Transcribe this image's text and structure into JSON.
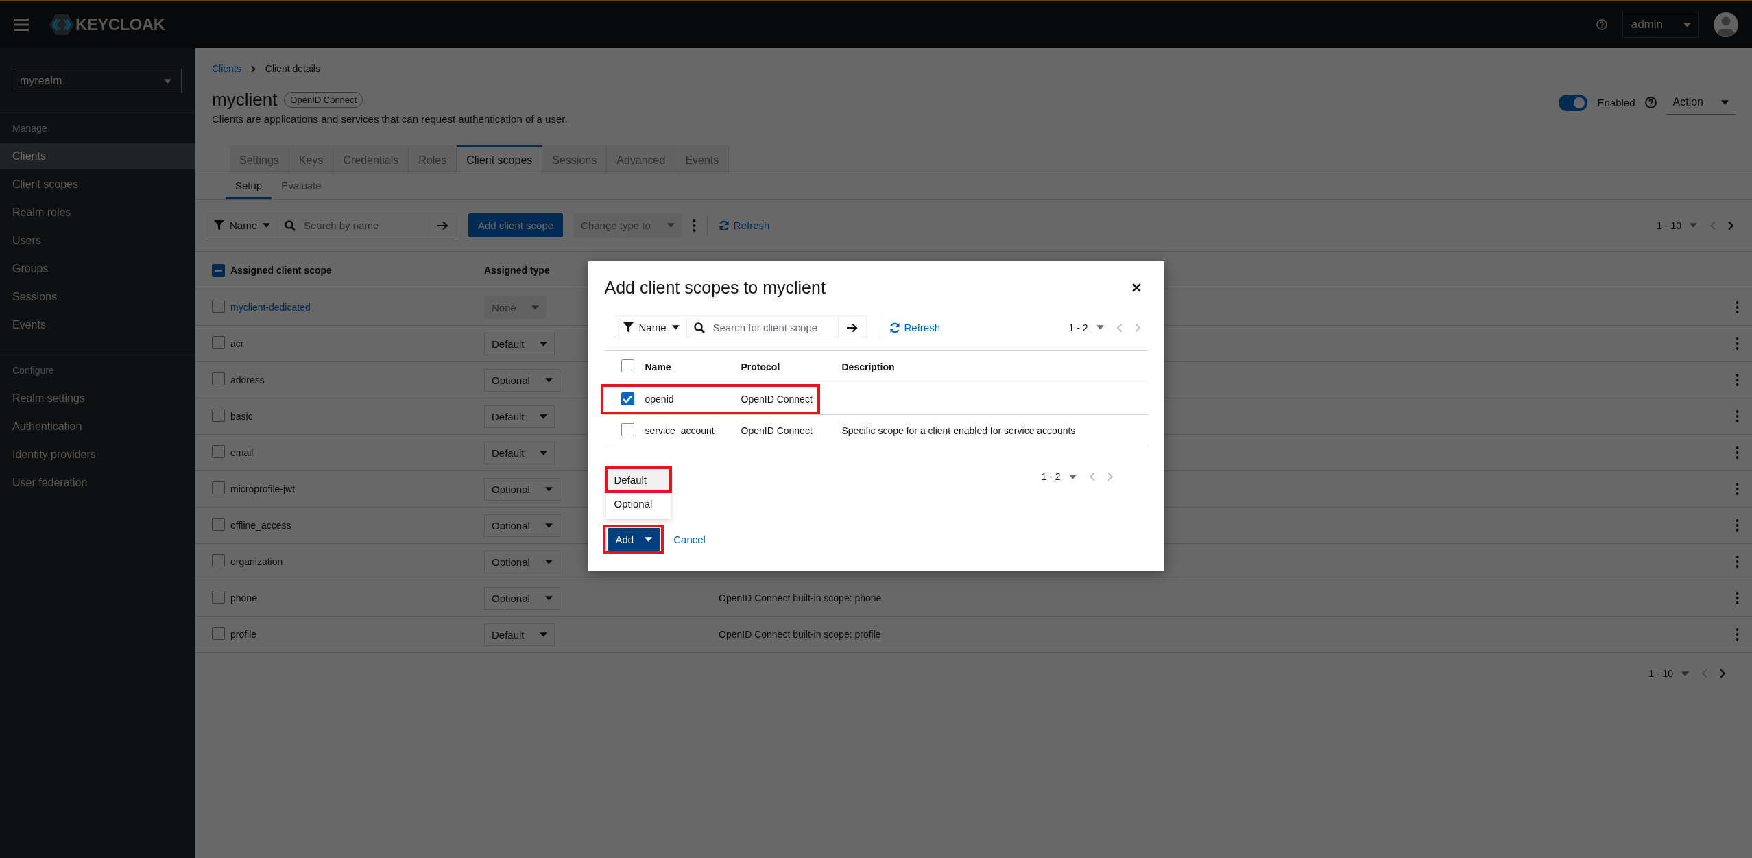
{
  "header": {
    "brand": "KEYCLOAK",
    "user": "admin"
  },
  "sidebar": {
    "realm": "myrealm",
    "sections": [
      {
        "title": "Manage",
        "items": [
          {
            "label": "Clients",
            "selected": true
          },
          {
            "label": "Client scopes",
            "selected": false
          },
          {
            "label": "Realm roles",
            "selected": false
          },
          {
            "label": "Users",
            "selected": false
          },
          {
            "label": "Groups",
            "selected": false
          },
          {
            "label": "Sessions",
            "selected": false
          },
          {
            "label": "Events",
            "selected": false
          }
        ]
      },
      {
        "title": "Configure",
        "items": [
          {
            "label": "Realm settings",
            "selected": false
          },
          {
            "label": "Authentication",
            "selected": false
          },
          {
            "label": "Identity providers",
            "selected": false
          },
          {
            "label": "User federation",
            "selected": false
          }
        ]
      }
    ]
  },
  "breadcrumb": [
    "Clients",
    "Client details"
  ],
  "client": {
    "name": "myclient",
    "protocol": "OpenID Connect",
    "description": "Clients are applications and services that can request authentication of a user.",
    "enabled": true,
    "enabled_label": "Enabled",
    "action": "Action"
  },
  "tabs": [
    {
      "label": "Settings",
      "selected": false
    },
    {
      "label": "Keys",
      "selected": false
    },
    {
      "label": "Credentials",
      "selected": false
    },
    {
      "label": "Roles",
      "selected": false
    },
    {
      "label": "Client scopes",
      "selected": true
    },
    {
      "label": "Sessions",
      "selected": false
    },
    {
      "label": "Advanced",
      "selected": false
    },
    {
      "label": "Events",
      "selected": false
    }
  ],
  "subtabs": [
    {
      "label": "Setup",
      "selected": true
    },
    {
      "label": "Evaluate",
      "selected": false
    }
  ],
  "toolbar": {
    "filter": "Name",
    "placeholder": "Search by name",
    "add_button": "Add client scope",
    "change_type": "Change type to",
    "change_type_disabled": true,
    "refresh": "Refresh",
    "pagination": {
      "label": "1 - 10",
      "prev_disabled": true,
      "next_disabled": false
    }
  },
  "table": {
    "columns": [
      "Assigned client scope",
      "Assigned type"
    ],
    "header_indeterminate": true,
    "rows": [
      {
        "name": "myclient-dedicated",
        "kind": "link",
        "type": "None",
        "type_disabled": true,
        "checked": false
      },
      {
        "name": "acr",
        "kind": "plain",
        "type": "Default",
        "type_disabled": false,
        "checked": false
      },
      {
        "name": "address",
        "kind": "plain",
        "type": "Optional",
        "type_disabled": false,
        "checked": false
      },
      {
        "name": "basic",
        "kind": "plain",
        "type": "Default",
        "type_disabled": false,
        "checked": false
      },
      {
        "name": "email",
        "kind": "plain",
        "type": "Default",
        "type_disabled": false,
        "checked": false
      },
      {
        "name": "microprofile-jwt",
        "kind": "plain",
        "type": "Optional",
        "type_disabled": false,
        "checked": false
      },
      {
        "name": "offline_access",
        "kind": "plain",
        "type": "Optional",
        "type_disabled": false,
        "checked": false
      },
      {
        "name": "organization",
        "kind": "plain",
        "type": "Optional",
        "type_disabled": false,
        "checked": false
      },
      {
        "name": "phone",
        "kind": "plain",
        "type": "Optional",
        "type_disabled": false,
        "checked": false,
        "description": "OpenID Connect built-in scope: phone"
      },
      {
        "name": "profile",
        "kind": "plain",
        "type": "Default",
        "type_disabled": false,
        "checked": false,
        "description": "OpenID Connect built-in scope: profile"
      }
    ]
  },
  "bottom_pagination": {
    "label": "1 - 10",
    "prev_disabled": true,
    "next_disabled": false
  },
  "modal": {
    "title": "Add client scopes to myclient",
    "filter": "Name",
    "placeholder": "Search for client scope",
    "refresh": "Refresh",
    "pagination": {
      "label": "1 - 2",
      "prev_disabled": true,
      "next_disabled": true
    },
    "columns": [
      "Name",
      "Protocol",
      "Description"
    ],
    "header_checked": false,
    "rows": [
      {
        "name": "openid",
        "protocol": "OpenID Connect",
        "checked": true,
        "highlighted": true
      },
      {
        "name": "service_account",
        "protocol": "OpenID Connect",
        "description": "Specific scope for a client enabled for service accounts",
        "checked": false,
        "highlighted": false
      }
    ],
    "bottom_pagination": {
      "label": "1 - 2",
      "prev_disabled": true,
      "next_disabled": true
    },
    "menu": [
      {
        "label": "Default",
        "selected": true,
        "highlighted": true
      },
      {
        "label": "Optional",
        "selected": false,
        "highlighted": false
      }
    ],
    "add_button": {
      "label": "Add",
      "highlighted": true
    },
    "cancel": "Cancel"
  }
}
